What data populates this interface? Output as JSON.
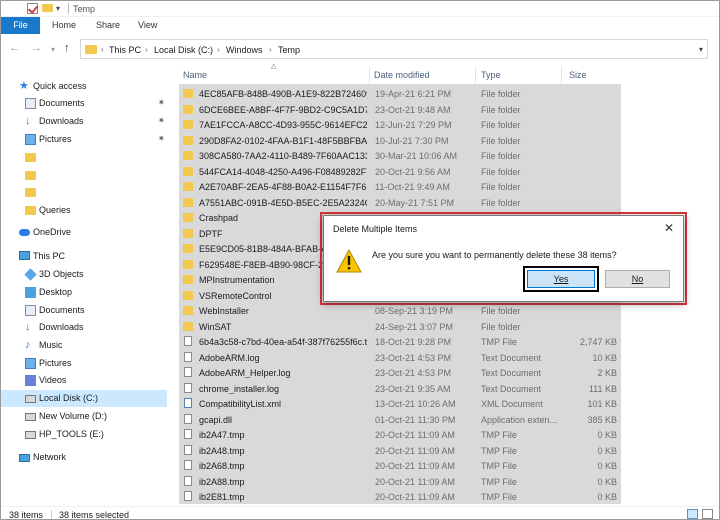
{
  "window": {
    "title": "Temp"
  },
  "ribbon": {
    "tabs": [
      "File",
      "Home",
      "Share",
      "View"
    ]
  },
  "address": {
    "crumbs": [
      "This PC",
      "Local Disk (C:)",
      "Windows",
      "Temp"
    ]
  },
  "nav": {
    "items": [
      {
        "label": "Quick access",
        "icon": "star-icon",
        "indent": 0,
        "pinned": false
      },
      {
        "label": "Documents",
        "icon": "documents-icon",
        "indent": 1,
        "pinned": true
      },
      {
        "label": "Downloads",
        "icon": "download-icon",
        "indent": 1,
        "pinned": true
      },
      {
        "label": "Pictures",
        "icon": "pictures-icon",
        "indent": 1,
        "pinned": true
      },
      {
        "label": "",
        "icon": "folder-icon",
        "indent": 1,
        "pinned": false
      },
      {
        "label": "",
        "icon": "folder-icon",
        "indent": 1,
        "pinned": false
      },
      {
        "label": "",
        "icon": "folder-icon",
        "indent": 1,
        "pinned": false
      },
      {
        "label": "Queries",
        "icon": "folder-icon",
        "indent": 1,
        "pinned": false
      },
      {
        "label": "OneDrive",
        "icon": "cloud-icon",
        "indent": 0,
        "pinned": false
      },
      {
        "label": "This PC",
        "icon": "computer-icon",
        "indent": 0,
        "pinned": false
      },
      {
        "label": "3D Objects",
        "icon": "3d-objects-icon",
        "indent": 1,
        "pinned": false
      },
      {
        "label": "Desktop",
        "icon": "desktop-icon",
        "indent": 1,
        "pinned": false
      },
      {
        "label": "Documents",
        "icon": "documents-icon",
        "indent": 1,
        "pinned": false
      },
      {
        "label": "Downloads",
        "icon": "download-icon",
        "indent": 1,
        "pinned": false
      },
      {
        "label": "Music",
        "icon": "music-icon",
        "indent": 1,
        "pinned": false
      },
      {
        "label": "Pictures",
        "icon": "pictures-icon",
        "indent": 1,
        "pinned": false
      },
      {
        "label": "Videos",
        "icon": "videos-icon",
        "indent": 1,
        "pinned": false
      },
      {
        "label": "Local Disk (C:)",
        "icon": "drive-icon",
        "indent": 1,
        "pinned": false,
        "selected": true
      },
      {
        "label": "New Volume (D:)",
        "icon": "drive-icon",
        "indent": 1,
        "pinned": false
      },
      {
        "label": "HP_TOOLS (E:)",
        "icon": "drive-icon",
        "indent": 1,
        "pinned": false
      },
      {
        "label": "Network",
        "icon": "network-icon",
        "indent": 0,
        "pinned": false
      }
    ]
  },
  "columns": {
    "name": "Name",
    "date": "Date modified",
    "type": "Type",
    "size": "Size"
  },
  "files": [
    {
      "name": "4EC85AFB-848B-490B-A1E9-822B724609B1",
      "date": "19-Apr-21 6:21 PM",
      "type": "File folder",
      "size": "",
      "icon": "folder"
    },
    {
      "name": "6DCE6BEE-A8BF-4F7F-9BD2-C9C5A1D74...",
      "date": "23-Oct-21 9:48 AM",
      "type": "File folder",
      "size": "",
      "icon": "folder"
    },
    {
      "name": "7AE1FCCA-A8CC-4D93-955C-9614EFC24...",
      "date": "12-Jun-21 7:29 PM",
      "type": "File folder",
      "size": "",
      "icon": "folder"
    },
    {
      "name": "290D8FA2-0102-4FAA-B1F1-48F5BBFBAB2E",
      "date": "10-Jul-21 7:30 PM",
      "type": "File folder",
      "size": "",
      "icon": "folder"
    },
    {
      "name": "308CA580-7AA2-4110-B489-7F60AAC133...",
      "date": "30-Mar-21 10:06 AM",
      "type": "File folder",
      "size": "",
      "icon": "folder"
    },
    {
      "name": "544FCA14-4048-4250-A496-F08489282F7...",
      "date": "20-Oct-21 9:56 AM",
      "type": "File folder",
      "size": "",
      "icon": "folder"
    },
    {
      "name": "A2E70ABF-2EA5-4F88-B0A2-E1154F7F6B5...",
      "date": "11-Oct-21 9:49 AM",
      "type": "File folder",
      "size": "",
      "icon": "folder"
    },
    {
      "name": "A7551ABC-091B-4E5D-B5EC-2E5A2324C2...",
      "date": "20-May-21 7:51 PM",
      "type": "File folder",
      "size": "",
      "icon": "folder"
    },
    {
      "name": "Crashpad",
      "date": "",
      "type": "",
      "size": "",
      "icon": "folder"
    },
    {
      "name": "DPTF",
      "date": "",
      "type": "",
      "size": "",
      "icon": "folder"
    },
    {
      "name": "E5E9CD05-81B8-484A-BFAB-A93C",
      "date": "",
      "type": "",
      "size": "",
      "icon": "folder"
    },
    {
      "name": "F629548E-F8EB-4B90-98CF-2B97C",
      "date": "",
      "type": "",
      "size": "",
      "icon": "folder"
    },
    {
      "name": "MPInstrumentation",
      "date": "",
      "type": "",
      "size": "",
      "icon": "folder"
    },
    {
      "name": "VSRemoteControl",
      "date": "",
      "type": "",
      "size": "",
      "icon": "folder"
    },
    {
      "name": "WebInstaller",
      "date": "08-Sep-21 3:19 PM",
      "type": "File folder",
      "size": "",
      "icon": "folder"
    },
    {
      "name": "WinSAT",
      "date": "24-Sep-21 3:07 PM",
      "type": "File folder",
      "size": "",
      "icon": "folder"
    },
    {
      "name": "6b4a3c58-c7bd-40ea-a54f-387f76255f6c.t...",
      "date": "18-Oct-21 9:28 PM",
      "type": "TMP File",
      "size": "2,747 KB",
      "icon": "file"
    },
    {
      "name": "AdobeARM.log",
      "date": "23-Oct-21 4:53 PM",
      "type": "Text Document",
      "size": "10 KB",
      "icon": "file"
    },
    {
      "name": "AdobeARM_Helper.log",
      "date": "23-Oct-21 4:53 PM",
      "type": "Text Document",
      "size": "2 KB",
      "icon": "file"
    },
    {
      "name": "chrome_installer.log",
      "date": "23-Oct-21 9:35 AM",
      "type": "Text Document",
      "size": "111 KB",
      "icon": "file"
    },
    {
      "name": "CompatibilityList.xml",
      "date": "13-Oct-21 10:26 AM",
      "type": "XML Document",
      "size": "101 KB",
      "icon": "xml"
    },
    {
      "name": "gcapi.dll",
      "date": "01-Oct-21 11:30 PM",
      "type": "Application exten...",
      "size": "385 KB",
      "icon": "file"
    },
    {
      "name": "ib2A47.tmp",
      "date": "20-Oct-21 11:09 AM",
      "type": "TMP File",
      "size": "0 KB",
      "icon": "file"
    },
    {
      "name": "ib2A48.tmp",
      "date": "20-Oct-21 11:09 AM",
      "type": "TMP File",
      "size": "0 KB",
      "icon": "file"
    },
    {
      "name": "ib2A68.tmp",
      "date": "20-Oct-21 11:09 AM",
      "type": "TMP File",
      "size": "0 KB",
      "icon": "file"
    },
    {
      "name": "ib2A88.tmp",
      "date": "20-Oct-21 11:09 AM",
      "type": "TMP File",
      "size": "0 KB",
      "icon": "file"
    },
    {
      "name": "ib2E81.tmp",
      "date": "20-Oct-21 11:09 AM",
      "type": "TMP File",
      "size": "0 KB",
      "icon": "file"
    }
  ],
  "status": {
    "count": "38 items",
    "selected": "38 items selected"
  },
  "dialog": {
    "title": "Delete Multiple Items",
    "message": "Are you sure you want to permanently delete these 38 items?",
    "yes": "Yes",
    "no": "No"
  },
  "colors": {
    "highlight": "#d6363b",
    "selection": "#d9d9d9",
    "file_tab": "#1979ca"
  }
}
